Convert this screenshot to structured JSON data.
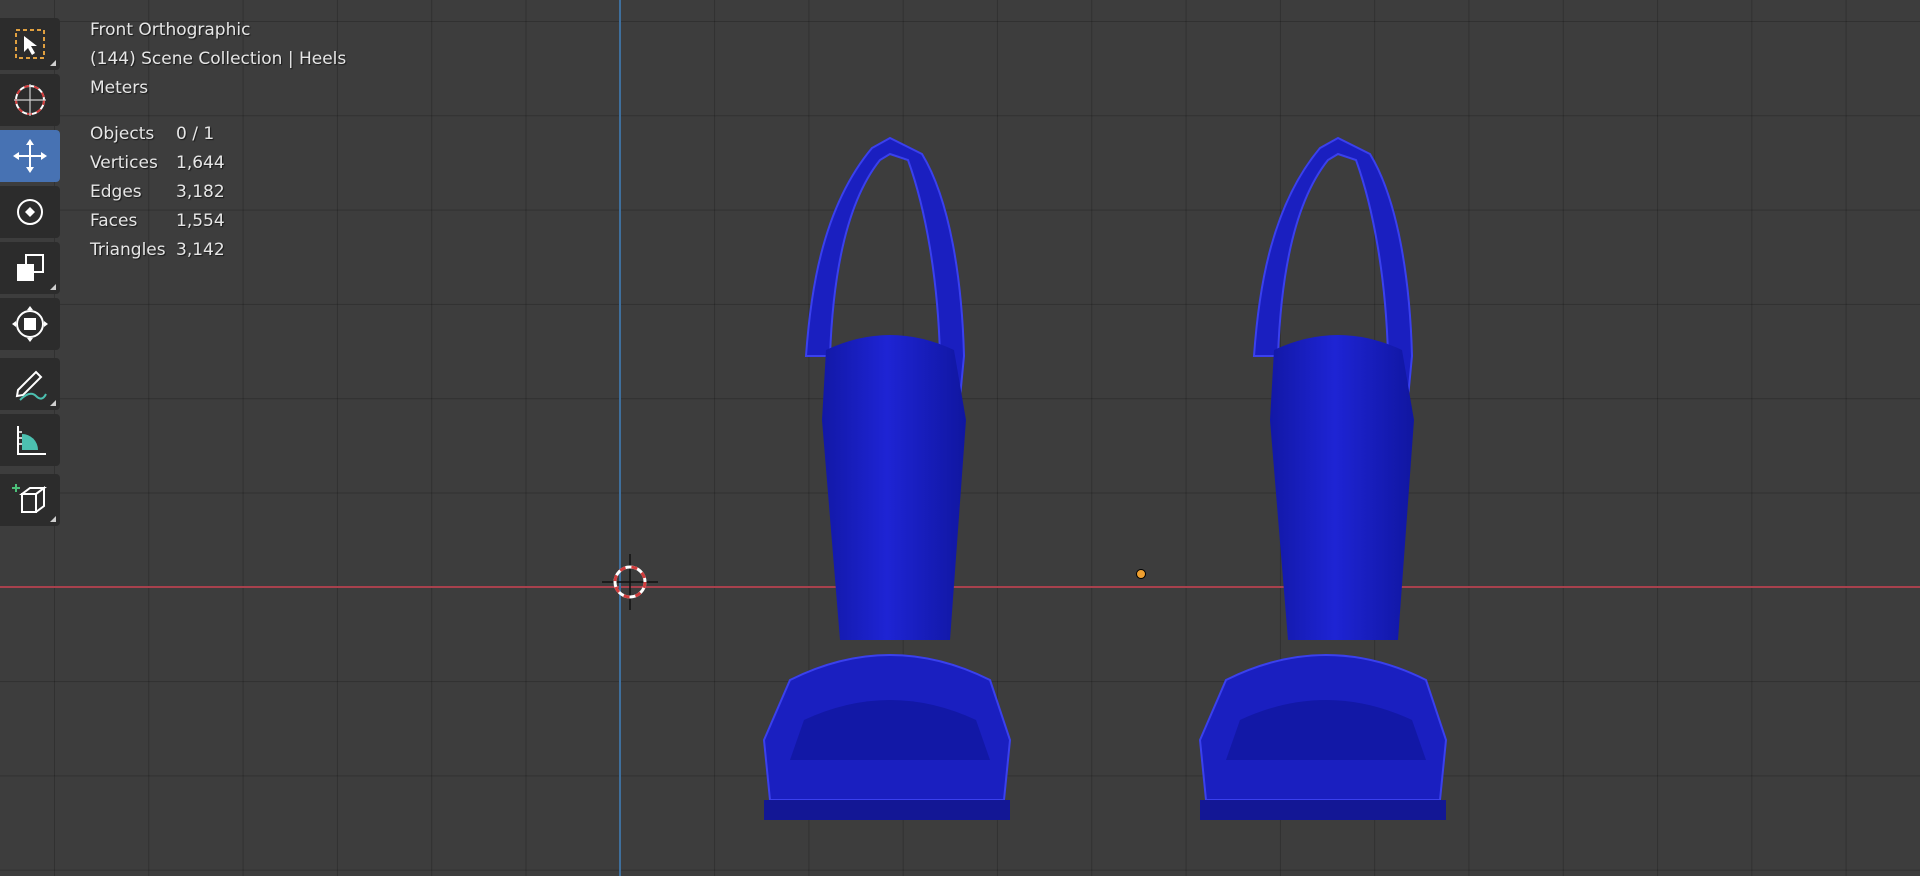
{
  "viewport": {
    "view_name": "Front Orthographic",
    "collection_line": "(144) Scene Collection | Heels",
    "units": "Meters",
    "stats": [
      {
        "label": "Objects",
        "value": "0 / 1"
      },
      {
        "label": "Vertices",
        "value": "1,644"
      },
      {
        "label": "Edges",
        "value": "3,182"
      },
      {
        "label": "Faces",
        "value": "1,554"
      },
      {
        "label": "Triangles",
        "value": "3,142"
      }
    ]
  },
  "toolbar": {
    "tools": [
      {
        "name": "select-box-tool",
        "icon": "select-box-icon",
        "active": false
      },
      {
        "name": "cursor-tool",
        "icon": "cursor-icon",
        "active": false
      },
      {
        "name": "move-tool",
        "icon": "move-icon",
        "active": true
      },
      {
        "name": "rotate-tool",
        "icon": "rotate-icon",
        "active": false
      },
      {
        "name": "scale-tool",
        "icon": "scale-icon",
        "active": false
      },
      {
        "name": "transform-tool",
        "icon": "transform-icon",
        "active": false
      },
      {
        "name": "annotate-tool",
        "icon": "annotate-icon",
        "active": false
      },
      {
        "name": "measure-tool",
        "icon": "measure-icon",
        "active": false
      },
      {
        "name": "add-cube-tool",
        "icon": "add-cube-icon",
        "active": false
      }
    ]
  },
  "colors": {
    "viewport_bg": "#3d3d3d",
    "active_tool": "#4772b3",
    "x_axis": "#a8414d",
    "z_axis": "#3f6f9c",
    "model": "#1a1ec8",
    "origin": "#f0a030"
  }
}
